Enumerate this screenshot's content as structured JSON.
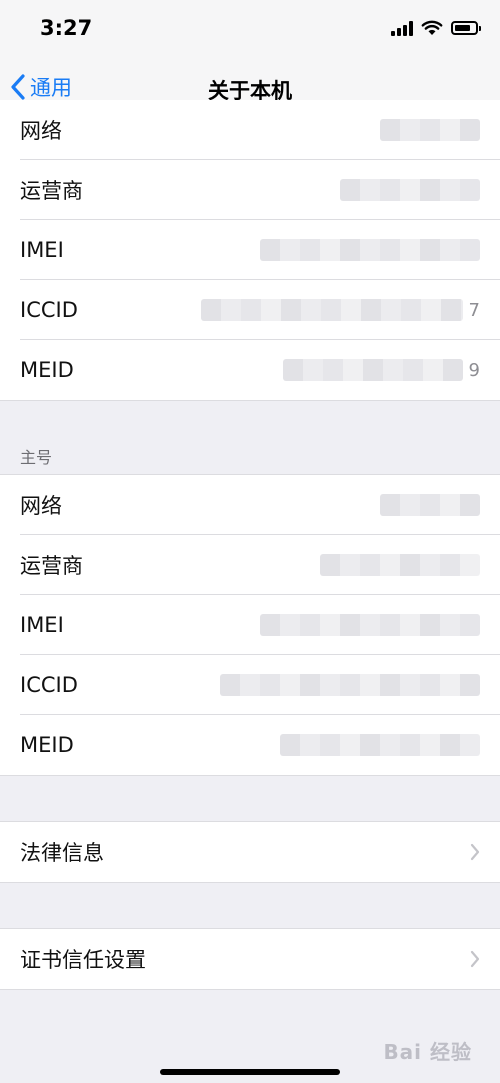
{
  "status_bar": {
    "time": "3:27"
  },
  "nav": {
    "back_label": "通用",
    "title": "关于本机"
  },
  "group1": {
    "rows": [
      {
        "label": "网络",
        "value": ""
      },
      {
        "label": "运营商",
        "value": ""
      },
      {
        "label": "IMEI",
        "value": ""
      },
      {
        "label": "ICCID",
        "value": "7"
      },
      {
        "label": "MEID",
        "value": "9"
      }
    ]
  },
  "group2": {
    "header": "主号",
    "rows": [
      {
        "label": "网络",
        "value": ""
      },
      {
        "label": "运营商",
        "value": ""
      },
      {
        "label": "IMEI",
        "value": ""
      },
      {
        "label": "ICCID",
        "value": ""
      },
      {
        "label": "MEID",
        "value": ""
      }
    ]
  },
  "legal": {
    "label": "法律信息"
  },
  "certificate": {
    "label": "证书信任设置"
  },
  "watermark": {
    "text": "Bai 经验"
  }
}
